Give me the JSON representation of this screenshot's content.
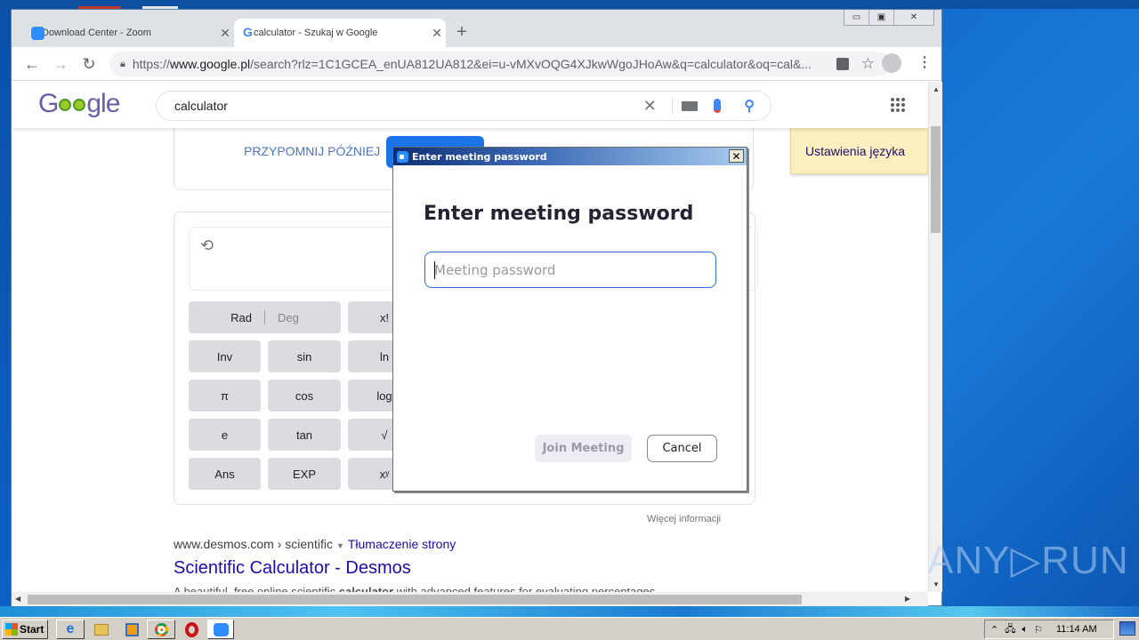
{
  "browser": {
    "tabs": [
      {
        "label": "Download Center - Zoom",
        "icon": "zoom-icon",
        "active": false
      },
      {
        "label": "calculator - Szukaj w Google",
        "icon": "google-icon",
        "active": true
      }
    ],
    "new_tab_label": "+",
    "close_glyph": "✕",
    "url_scheme": "https://",
    "url_host": "www.google.pl",
    "url_path": "/search?rlz=1C1GCEA_enUA812UA812&ei=u-vMXvOQG4XJkwWgoJHoAw&q=calculator&oq=cal&..."
  },
  "google": {
    "logo_text": "Google",
    "search_value": "calculator",
    "remind_later": "PRZYPOMNIJ PÓŹNIEJ",
    "language_settings": "Ustawienia języka",
    "calculator": {
      "rows": [
        [
          {
            "label": "Rad",
            "alt": "Deg"
          },
          {
            "label": "x!"
          }
        ],
        [
          {
            "label": "Inv"
          },
          {
            "label": "sin"
          },
          {
            "label": "ln"
          }
        ],
        [
          {
            "label": "π"
          },
          {
            "label": "cos"
          },
          {
            "label": "log"
          }
        ],
        [
          {
            "label": "e"
          },
          {
            "label": "tan"
          },
          {
            "label": "√"
          }
        ],
        [
          {
            "label": "Ans"
          },
          {
            "label": "EXP"
          },
          {
            "label": "xʸ"
          }
        ]
      ]
    },
    "more_info": "Więcej informacji",
    "result": {
      "cite_host": "www.desmos.com",
      "cite_path": "› scientific",
      "translate": "Tłumaczenie strony",
      "title": "Scientific Calculator - Desmos",
      "snippet_pre": "A beautiful, free online scientific ",
      "snippet_bold": "calculator",
      "snippet_post": " with advanced features for evaluating percentages,"
    }
  },
  "dialog": {
    "window_title": "Enter meeting password",
    "heading": "Enter meeting password",
    "password_value": "",
    "password_placeholder": "Meeting password",
    "join_label": "Join Meeting",
    "cancel_label": "Cancel",
    "close_glyph": "✕"
  },
  "watermark": "ANY▷RUN",
  "taskbar": {
    "start_label": "Start",
    "apps": [
      "internet-explorer",
      "file-explorer",
      "media-player",
      "chrome",
      "opera",
      "zoom"
    ],
    "clock": "11:14 AM"
  }
}
